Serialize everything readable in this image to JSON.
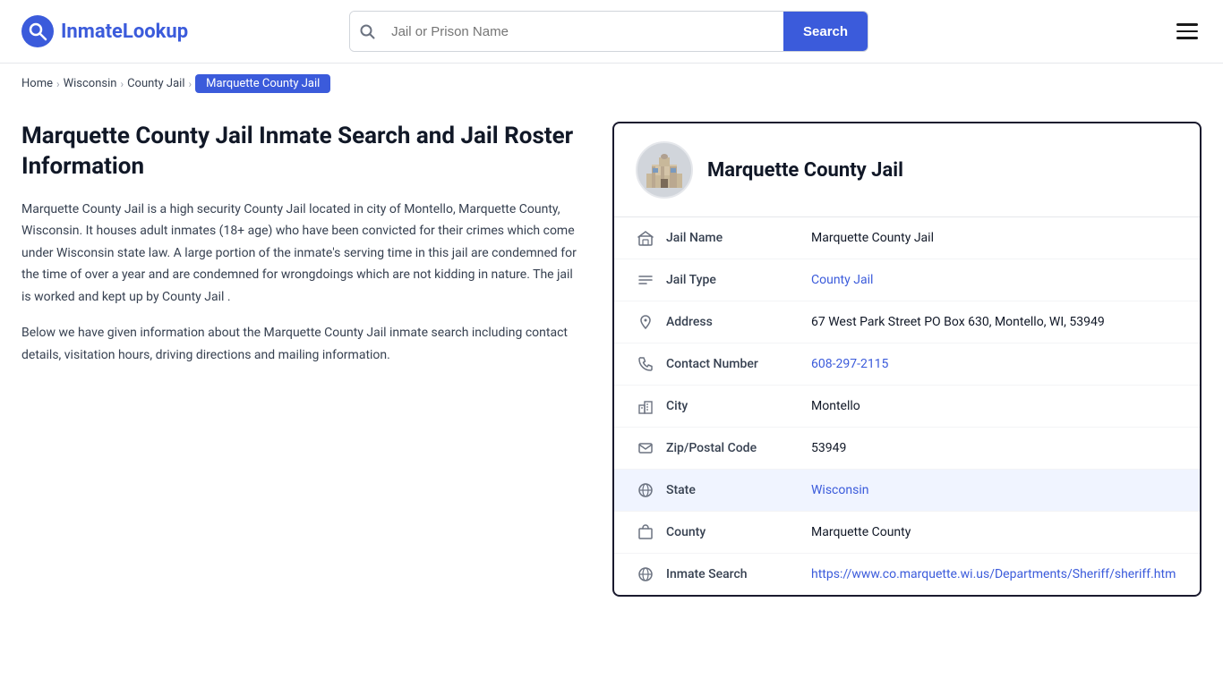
{
  "header": {
    "logo_text_black": "Inmate",
    "logo_text_blue": "Lookup",
    "search_placeholder": "Jail or Prison Name",
    "search_button_label": "Search",
    "menu_icon": "☰"
  },
  "breadcrumb": {
    "home": "Home",
    "state": "Wisconsin",
    "type": "County Jail",
    "current": "Marquette County Jail"
  },
  "left": {
    "title": "Marquette County Jail Inmate Search and Jail Roster Information",
    "desc1": "Marquette County Jail is a high security County Jail located in city of Montello, Marquette County, Wisconsin. It houses adult inmates (18+ age) who have been convicted for their crimes which come under Wisconsin state law. A large portion of the inmate's serving time in this jail are condemned for the time of over a year and are condemned for wrongdoings which are not kidding in nature. The jail is worked and kept up by County Jail .",
    "desc2": "Below we have given information about the Marquette County Jail inmate search including contact details, visitation hours, driving directions and mailing information."
  },
  "panel": {
    "title": "Marquette County Jail",
    "rows": [
      {
        "id": "jail-name",
        "icon": "jail",
        "label": "Jail Name",
        "value": "Marquette County Jail",
        "link": null,
        "highlighted": false
      },
      {
        "id": "jail-type",
        "icon": "list",
        "label": "Jail Type",
        "value": "County Jail",
        "link": "#",
        "highlighted": false
      },
      {
        "id": "address",
        "icon": "pin",
        "label": "Address",
        "value": "67 West Park Street PO Box 630, Montello, WI, 53949",
        "link": null,
        "highlighted": false
      },
      {
        "id": "contact",
        "icon": "phone",
        "label": "Contact Number",
        "value": "608-297-2115",
        "link": "tel:608-297-2115",
        "highlighted": false
      },
      {
        "id": "city",
        "icon": "city",
        "label": "City",
        "value": "Montello",
        "link": null,
        "highlighted": false
      },
      {
        "id": "zip",
        "icon": "mail",
        "label": "Zip/Postal Code",
        "value": "53949",
        "link": null,
        "highlighted": false
      },
      {
        "id": "state",
        "icon": "globe",
        "label": "State",
        "value": "Wisconsin",
        "link": "#",
        "highlighted": true
      },
      {
        "id": "county",
        "icon": "county",
        "label": "County",
        "value": "Marquette County",
        "link": null,
        "highlighted": false
      },
      {
        "id": "inmate-search",
        "icon": "globe2",
        "label": "Inmate Search",
        "value": "https://www.co.marquette.wi.us/Departments/Sheriff/sheriff.htm",
        "link": "https://www.co.marquette.wi.us/Departments/Sheriff/sheriff.htm",
        "highlighted": false
      }
    ]
  }
}
